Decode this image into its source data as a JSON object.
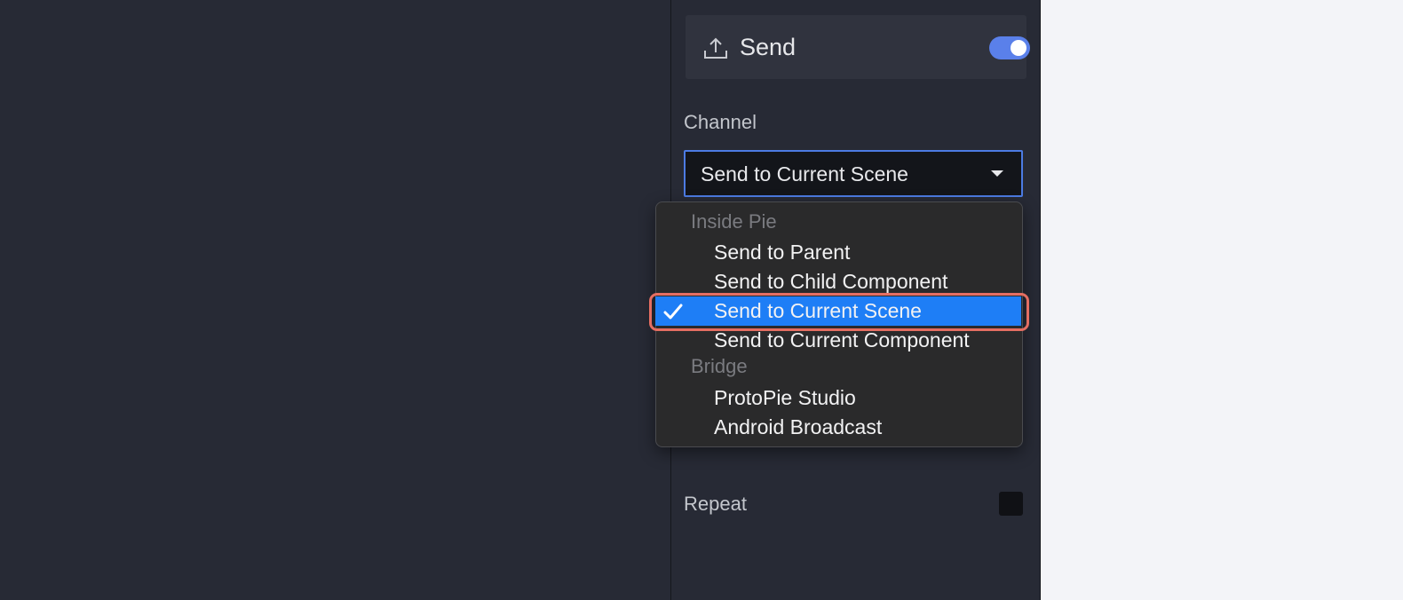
{
  "panel": {
    "send_title": "Send",
    "send_enabled": true,
    "channel_label": "Channel",
    "channel_value": "Send to Current Scene",
    "repeat_label": "Repeat",
    "repeat_checked": false
  },
  "dropdown": {
    "groups": [
      {
        "label": "Inside Pie",
        "items": [
          "Send to Parent",
          "Send to Child Component",
          "Send to Current Scene",
          "Send to Current Component"
        ]
      },
      {
        "label": "Bridge",
        "items": [
          "ProtoPie Studio",
          "Android Broadcast"
        ]
      }
    ],
    "selected": "Send to Current Scene"
  },
  "colors": {
    "accent": "#5a80ea",
    "selection": "#1e7ef6",
    "highlight": "#e46e62"
  },
  "icons": {
    "send": "upload-icon",
    "caret": "caret-down-icon",
    "check": "checkmark-icon"
  }
}
